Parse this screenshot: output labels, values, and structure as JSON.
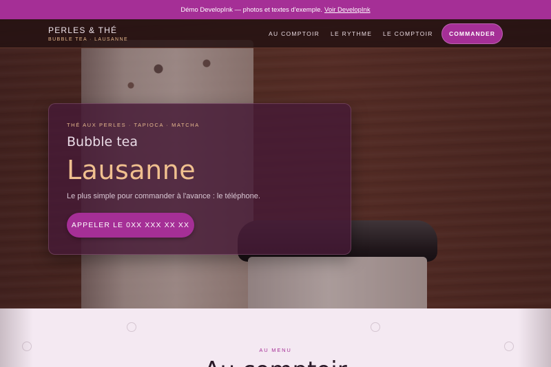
{
  "demo_bar": {
    "text": "Démo DevelopInk — photos et textes d'exemple.",
    "link": "Voir DevelopInk"
  },
  "brand": {
    "name": "PERLES & THÉ",
    "subtitle": "BUBBLE TEA · LAUSANNE"
  },
  "nav": {
    "items": [
      {
        "label": "AU COMPTOIR"
      },
      {
        "label": "LE RYTHME"
      },
      {
        "label": "LE COMPTOIR"
      }
    ],
    "cta": "COMMANDER"
  },
  "hero": {
    "kicker": "THÉ AUX PERLES · TAPIOCA · MATCHA",
    "title_line1": "Bubble tea",
    "title_line2": "Lausanne",
    "text": "Le plus simple pour commander à l'avance : le téléphone.",
    "button": "APPELER LE 0XX XXX XX XX"
  },
  "menu": {
    "kicker": "AU MENU",
    "title": "Au comptoir"
  },
  "colors": {
    "accent": "#a52f96",
    "gold": "#f0c08f",
    "nav_bg": "#261212"
  }
}
